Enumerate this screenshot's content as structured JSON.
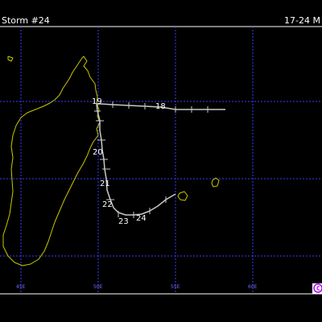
{
  "header": {
    "storm_label": "Storm #24",
    "date_range": "17-24 M"
  },
  "grid": {
    "longitude_labels": [
      "45E",
      "50E",
      "55E",
      "60E"
    ]
  },
  "track": {
    "day_labels": [
      "18",
      "19",
      "20",
      "21",
      "22",
      "23",
      "24"
    ]
  },
  "colors": {
    "background": "#000000",
    "coastline": "#c8c800",
    "grid": "#3a3aff",
    "track": "#c8c8c8",
    "frame": "#ffffff",
    "logo": "#b000ff"
  },
  "icons": {
    "logo": "copyright-logo-icon"
  }
}
